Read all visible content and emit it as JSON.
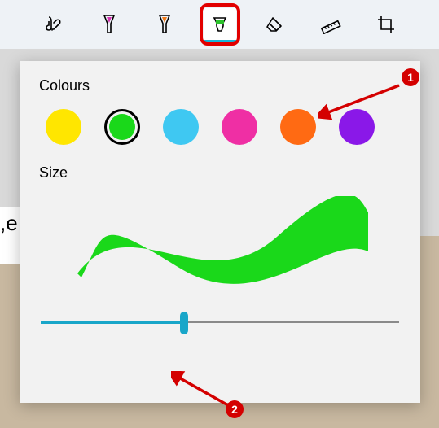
{
  "toolbar": {
    "tools": [
      {
        "name": "touch-writing",
        "selected": false
      },
      {
        "name": "pen-magenta",
        "selected": false,
        "accent": "#d633b3"
      },
      {
        "name": "pen-orange",
        "selected": false,
        "accent": "#f07a1a"
      },
      {
        "name": "highlighter-green",
        "selected": true,
        "accent": "#2cc22c"
      },
      {
        "name": "eraser",
        "selected": false
      },
      {
        "name": "ruler",
        "selected": false
      },
      {
        "name": "crop",
        "selected": false
      }
    ]
  },
  "popup": {
    "colours_label": "Colours",
    "size_label": "Size",
    "swatches": [
      {
        "color": "#ffe600",
        "selected": false
      },
      {
        "color": "#1ad81a",
        "selected": true
      },
      {
        "color": "#3fc8f2",
        "selected": false
      },
      {
        "color": "#ef2fa4",
        "selected": false
      },
      {
        "color": "#ff6a13",
        "selected": false
      },
      {
        "color": "#8a18e8",
        "selected": false
      }
    ],
    "stroke_colour": "#1ad81a",
    "slider_percent": 40
  },
  "background_text": ",e",
  "annotations": {
    "1": "1",
    "2": "2"
  }
}
